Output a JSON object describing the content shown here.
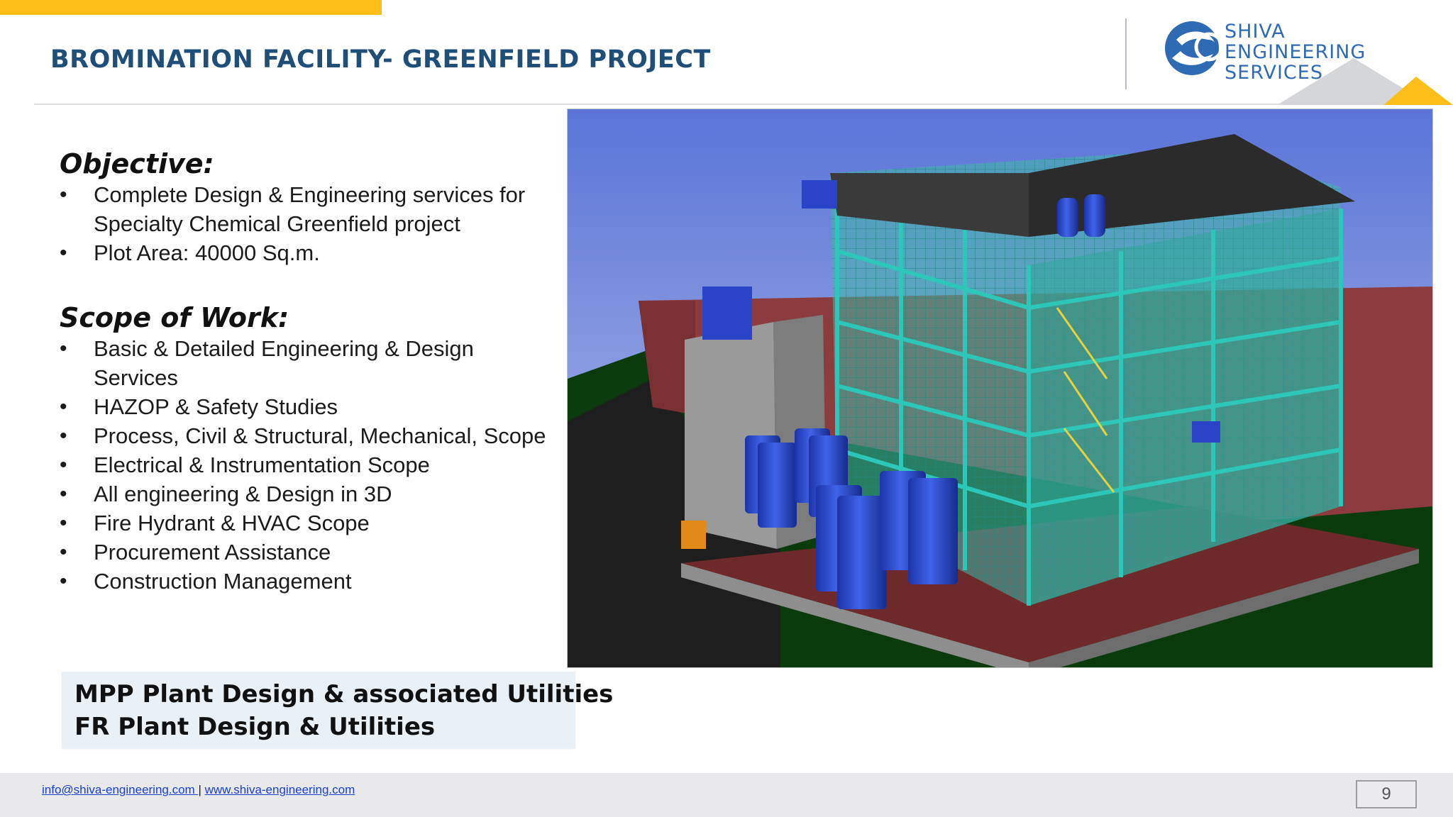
{
  "header": {
    "title": "BROMINATION FACILITY- GREENFIELD PROJECT",
    "accent_color": "#FDBE19",
    "title_color": "#1F4E79"
  },
  "logo": {
    "icon": "shiva-engineering-logo-icon",
    "lines": [
      "SHIVA",
      "ENGINEERING",
      "SERVICES"
    ],
    "color": "#2F6BB4"
  },
  "objective": {
    "heading": "Objective:",
    "items": [
      "Complete Design & Engineering services for Specialty Chemical Greenfield project",
      "Plot Area: 40000 Sq.m."
    ]
  },
  "scope": {
    "heading": "Scope of Work:",
    "items": [
      "Basic & Detailed Engineering & Design Services",
      "HAZOP & Safety Studies",
      "Process, Civil & Structural, Mechanical, Scope",
      "Electrical & Instrumentation Scope",
      "All engineering & Design in 3D",
      "Fire Hydrant & HVAC Scope",
      "Procurement Assistance",
      "Construction Management"
    ]
  },
  "callout": {
    "line1": "MPP Plant Design & associated Utilities",
    "line2": "FR Plant Design & Utilities"
  },
  "render_image": {
    "icon": "plant-3d-model-render"
  },
  "footer": {
    "email": "info@shiva-engineering.com ",
    "separator": "|",
    "website": "www.shiva-engineering.com",
    "page_number": "9"
  }
}
